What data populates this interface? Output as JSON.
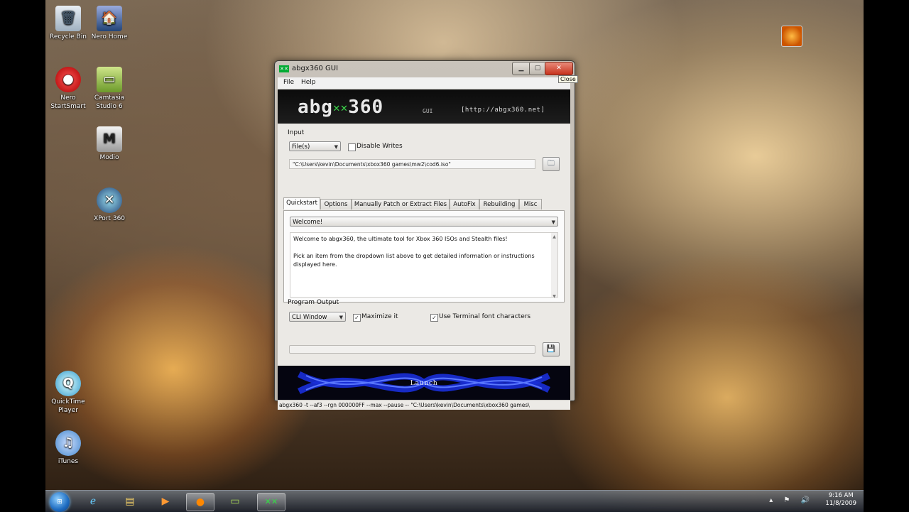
{
  "desktop": {
    "icons": [
      {
        "label": "Recycle Bin",
        "glyph": "🗑"
      },
      {
        "label": "Nero Home",
        "glyph": "🏠"
      },
      {
        "label": "Nero StartSmart",
        "glyph": "●"
      },
      {
        "label": "Camtasia Studio 6",
        "glyph": "▭"
      },
      {
        "label": "Modio",
        "glyph": "M"
      },
      {
        "label": "XPort 360",
        "glyph": "✕"
      },
      {
        "label": "QuickTime Player",
        "glyph": "Q"
      },
      {
        "label": "iTunes",
        "glyph": "♫"
      }
    ]
  },
  "window": {
    "title": "abgx360 GUI",
    "close_tooltip": "Close",
    "menu": {
      "file": "File",
      "help": "Help"
    },
    "banner": {
      "logo_left": "abg",
      "logo_xx": "✕✕",
      "logo_right": "360",
      "gui": "GUI",
      "url": "[http://abgx360.net]"
    },
    "input": {
      "label": "Input",
      "source_select": "File(s)",
      "disable_writes_label": "Disable Writes",
      "disable_writes_checked": false,
      "path_value": "\"C:\\Users\\kevin\\Documents\\xbox360 games\\mw2\\cod6.iso\""
    },
    "tabs": [
      "Quickstart",
      "Options",
      "Manually Patch or Extract Files",
      "AutoFix",
      "Rebuilding",
      "Misc"
    ],
    "active_tab": "Quickstart",
    "quickstart": {
      "select": "Welcome!",
      "line1": "Welcome to abgx360, the ultimate tool for Xbox 360 ISOs and Stealth files!",
      "line2": "Pick an item from the dropdown list above to get detailed information or instructions displayed here."
    },
    "output": {
      "label": "Program Output",
      "mode_select": "CLI Window",
      "maximize_label": "Maximize it",
      "maximize_checked": true,
      "terminal_font_label": "Use Terminal font characters",
      "terminal_font_checked": true
    },
    "launch_label": "Launch",
    "status_command": "abgx360 -t --af3 --rgn 000000FF --max --pause -- \"C:\\Users\\kevin\\Documents\\xbox360 games\\"
  },
  "taskbar": {
    "items": [
      "start-orb",
      "internet-explorer",
      "windows-explorer",
      "media-player",
      "nero",
      "camtasia",
      "abgx360"
    ],
    "clock_time": "9:16 AM",
    "clock_date": "11/8/2009"
  }
}
